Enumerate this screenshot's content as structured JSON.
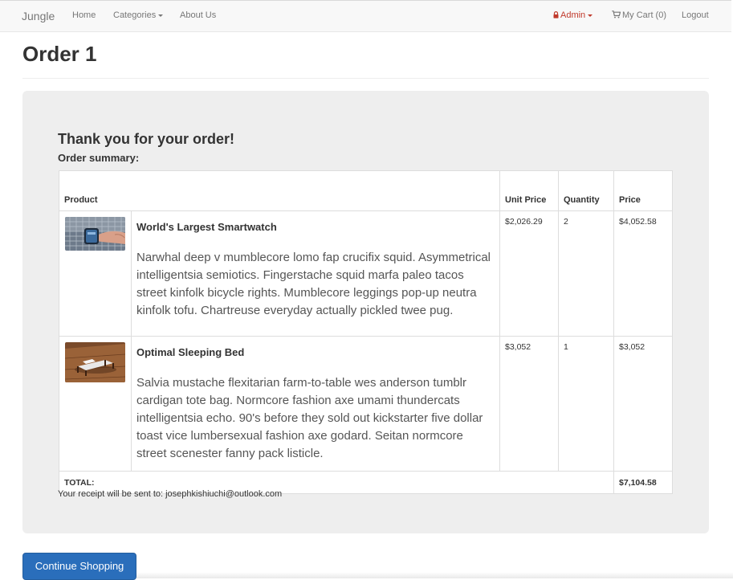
{
  "navbar": {
    "brand": "Jungle",
    "home": "Home",
    "categories": "Categories",
    "about": "About Us",
    "admin": "Admin",
    "cart": "My Cart (0)",
    "logout": "Logout",
    "colors": {
      "admin": "#c0392b",
      "text": "#777777"
    }
  },
  "page": {
    "title": "Order 1"
  },
  "order": {
    "thanks": "Thank you for your order!",
    "summary_label": "Order summary:",
    "headers": {
      "product": "Product",
      "unit_price": "Unit Price",
      "quantity": "Quantity",
      "price": "Price"
    },
    "items": [
      {
        "name": "World's Largest Smartwatch",
        "description": "Narwhal deep v mumblecore lomo fap crucifix squid. Asymmetrical intelligentsia semiotics. Fingerstache squid marfa paleo tacos street kinfolk bicycle rights. Mumblecore leggings pop-up neutra kinfolk tofu. Chartreuse everyday actually pickled twee pug.",
        "unit_price": "$2,026.29",
        "quantity": "2",
        "price": "$4,052.58",
        "image": "smartwatch-photo"
      },
      {
        "name": "Optimal Sleeping Bed",
        "description": "Salvia mustache flexitarian farm-to-table wes anderson tumblr cardigan tote bag. Normcore fashion axe umami thundercats intelligentsia echo. 90's before they sold out kickstarter five dollar toast vice lumbersexual fashion axe godard. Seitan normcore street scenester fanny pack listicle.",
        "unit_price": "$3,052",
        "quantity": "1",
        "price": "$3,052",
        "image": "bed-photo"
      }
    ],
    "total_label": "TOTAL:",
    "total": "$7,104.58",
    "receipt": "Your receipt will be sent to: josephkishiuchi@outlook.com"
  },
  "actions": {
    "continue_label": "Continue Shopping",
    "button_color": "#2a6ebb"
  }
}
